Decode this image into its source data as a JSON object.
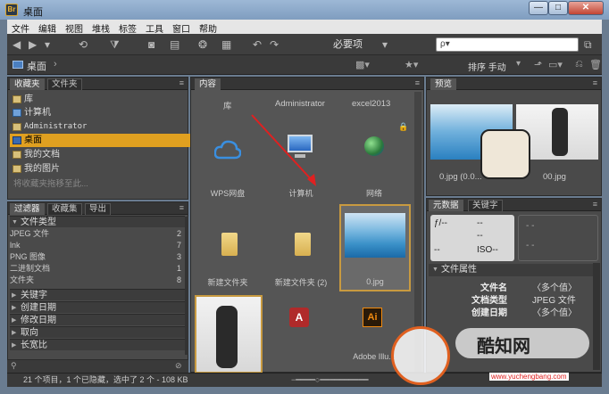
{
  "window": {
    "title": "桌面",
    "app_icon": "Br"
  },
  "menu": [
    "文件",
    "编辑",
    "视图",
    "堆栈",
    "标签",
    "工具",
    "窗口",
    "帮助"
  ],
  "toolbar": {
    "workspace": "必要项",
    "search_placeholder": "ρ▾"
  },
  "pathbar": {
    "location": "桌面",
    "sort_label": "排序 手动"
  },
  "left_panel": {
    "tabs": [
      "收藏夹",
      "文件夹"
    ],
    "favorites": [
      "库",
      "计算机",
      "Administrator",
      "桌面",
      "我的文档",
      "我的图片"
    ],
    "selected_favorite": "桌面",
    "drag_hint": "将收藏夹拖移至此..."
  },
  "filter_panel": {
    "tabs": [
      "过滤器",
      "收藏集",
      "导出"
    ],
    "file_type_header": "文件类型",
    "file_types": [
      {
        "name": "JPEG 文件",
        "count": "2"
      },
      {
        "name": "lnk",
        "count": "7"
      },
      {
        "name": "PNG 图像",
        "count": "3"
      },
      {
        "name": "二进制文档",
        "count": "1"
      },
      {
        "name": "文件夹",
        "count": "8"
      }
    ],
    "sections": [
      "关键字",
      "创建日期",
      "修改日期",
      "取向",
      "长宽比"
    ]
  },
  "content": {
    "tab": "内容",
    "top_labels": [
      "库",
      "Administrator",
      "excel2013"
    ],
    "items": [
      {
        "label": "WPS网盘",
        "kind": "cloud"
      },
      {
        "label": "计算机",
        "kind": "computer"
      },
      {
        "label": "网络",
        "kind": "network"
      },
      {
        "label": "新建文件夹",
        "kind": "folder"
      },
      {
        "label": "新建文件夹 (2)",
        "kind": "folder"
      },
      {
        "label": "0.jpg",
        "kind": "photo"
      },
      {
        "label": "",
        "kind": "photo2"
      },
      {
        "label": "",
        "kind": "access"
      },
      {
        "label": "Adobe Illu...",
        "kind": "ai"
      }
    ]
  },
  "preview": {
    "tab": "预览",
    "captions": [
      "0.jpg (0.0...",
      "00.jpg"
    ]
  },
  "metadata": {
    "tabs": [
      "元数据",
      "关键字"
    ],
    "exif": [
      "ƒ/--",
      "--",
      "--",
      "--",
      "ISO--"
    ],
    "section": "文件属性",
    "fields": [
      {
        "key": "文件名",
        "value": "〈多个值〉"
      },
      {
        "key": "文档类型",
        "value": "JPEG 文件"
      },
      {
        "key": "创建日期",
        "value": "〈多个值〉"
      }
    ]
  },
  "status": {
    "text": "21 个项目，1 个已隐藏，选中了 2 个 - 108 KB"
  },
  "watermark": {
    "text": "酷知网",
    "url": "www.yuchengbang.com"
  }
}
